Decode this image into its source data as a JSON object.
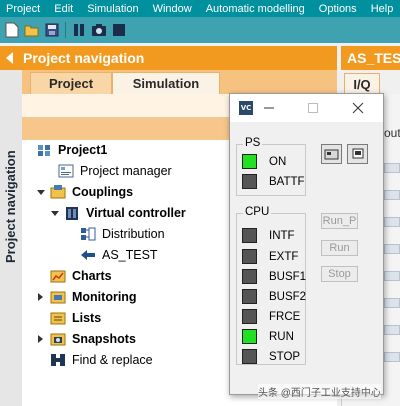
{
  "menu": [
    "Project",
    "Edit",
    "Simulation",
    "Window",
    "Automatic modelling",
    "Options",
    "Help"
  ],
  "toolbar_icons": [
    "new-icon",
    "open-icon",
    "save-icon",
    "pause-icon",
    "snapshot-icon",
    "stop-icon"
  ],
  "project_navigation": {
    "title": "Project navigation",
    "side_tab": "Project navigation",
    "tabs": [
      "Project",
      "Simulation"
    ],
    "active_tab": "Simulation",
    "tree": [
      {
        "label": "Project1",
        "bold": true,
        "icon": "project-icon"
      },
      {
        "label": "Project manager",
        "bold": false,
        "icon": "project-manager-icon"
      },
      {
        "label": "Couplings",
        "bold": true,
        "icon": "couplings-icon"
      },
      {
        "label": "Virtual controller",
        "bold": true,
        "icon": "virtual-controller-icon"
      },
      {
        "label": "Distribution",
        "bold": false,
        "icon": "distribution-icon"
      },
      {
        "label": "AS_TEST",
        "bold": false,
        "icon": "arrow-left-icon"
      },
      {
        "label": "Charts",
        "bold": true,
        "icon": "charts-icon"
      },
      {
        "label": "Monitoring",
        "bold": true,
        "icon": "monitoring-icon"
      },
      {
        "label": "Lists",
        "bold": true,
        "icon": "lists-icon"
      },
      {
        "label": "Snapshots",
        "bold": true,
        "icon": "snapshots-icon"
      },
      {
        "label": "Find & replace",
        "bold": false,
        "icon": "find-replace-icon"
      }
    ]
  },
  "right_panel": {
    "title": "AS_TEST",
    "tab": "I/Q",
    "partial_text": "out"
  },
  "vc_window": {
    "icon_text": "VC",
    "ps_group": "PS",
    "ps_leds": [
      {
        "label": "ON",
        "state": "on"
      },
      {
        "label": "BATTF",
        "state": "off"
      }
    ],
    "cpu_group": "CPU",
    "cpu_leds": [
      {
        "label": "INTF",
        "state": "off"
      },
      {
        "label": "EXTF",
        "state": "off"
      },
      {
        "label": "BUSF1",
        "state": "off"
      },
      {
        "label": "BUSF2",
        "state": "off"
      },
      {
        "label": "FRCE",
        "state": "off"
      },
      {
        "label": "RUN",
        "state": "on"
      },
      {
        "label": "STOP",
        "state": "off"
      }
    ],
    "buttons": [
      "Run_P",
      "Run",
      "Stop"
    ]
  },
  "colors": {
    "led_on": "#22e022",
    "led_off": "#555555",
    "accent_orange": "#f29a1f",
    "menubar": "#00909e"
  },
  "watermark": "头条 @西门子工业支持中心"
}
